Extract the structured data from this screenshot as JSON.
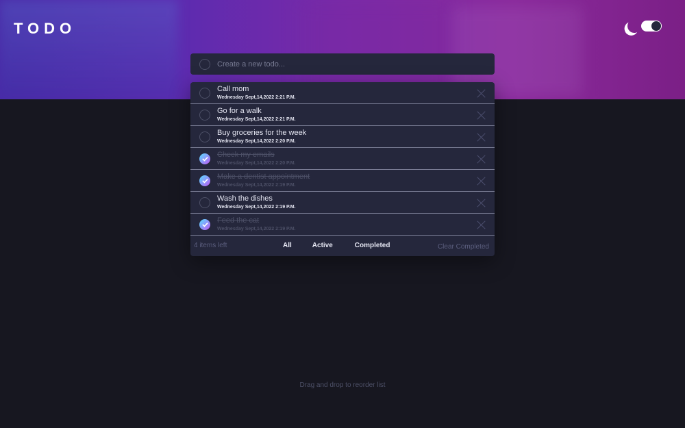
{
  "app": {
    "title": "TODO"
  },
  "theme": {
    "icon": "moon-icon",
    "mode": "dark"
  },
  "colors": {
    "background": "#171720",
    "card": "#25273c",
    "check_gradient_start": "#57ddff",
    "check_gradient_end": "#c058f3",
    "hero_start": "#4a2aa8",
    "hero_end": "#7b1f86"
  },
  "create": {
    "placeholder": "Create a new todo..."
  },
  "todos": [
    {
      "title": "Call mom",
      "date": "Wednesday Sept,14,2022 2:21 P.M.",
      "completed": false
    },
    {
      "title": "Go for a walk",
      "date": "Wednesday Sept,14,2022 2:21 P.M.",
      "completed": false
    },
    {
      "title": "Buy groceries for the week",
      "date": "Wednesday Sept,14,2022 2:20 P.M.",
      "completed": false
    },
    {
      "title": "Check my emails",
      "date": "Wednesday Sept,14,2022 2:20 P.M.",
      "completed": true
    },
    {
      "title": "Make a dentist appointment",
      "date": "Wednesday Sept,14,2022 2:19 P.M.",
      "completed": true
    },
    {
      "title": "Wash the dishes",
      "date": "Wednesday Sept,14,2022 2:19 P.M.",
      "completed": false
    },
    {
      "title": "Feed the cat",
      "date": "Wednesday Sept,14,2022 2:19 P.M.",
      "completed": true
    }
  ],
  "footer": {
    "items_left": "4 items left",
    "filters": [
      "All",
      "Active",
      "Completed"
    ],
    "clear": "Clear Completed"
  },
  "hint": "Drag and drop to reorder list"
}
